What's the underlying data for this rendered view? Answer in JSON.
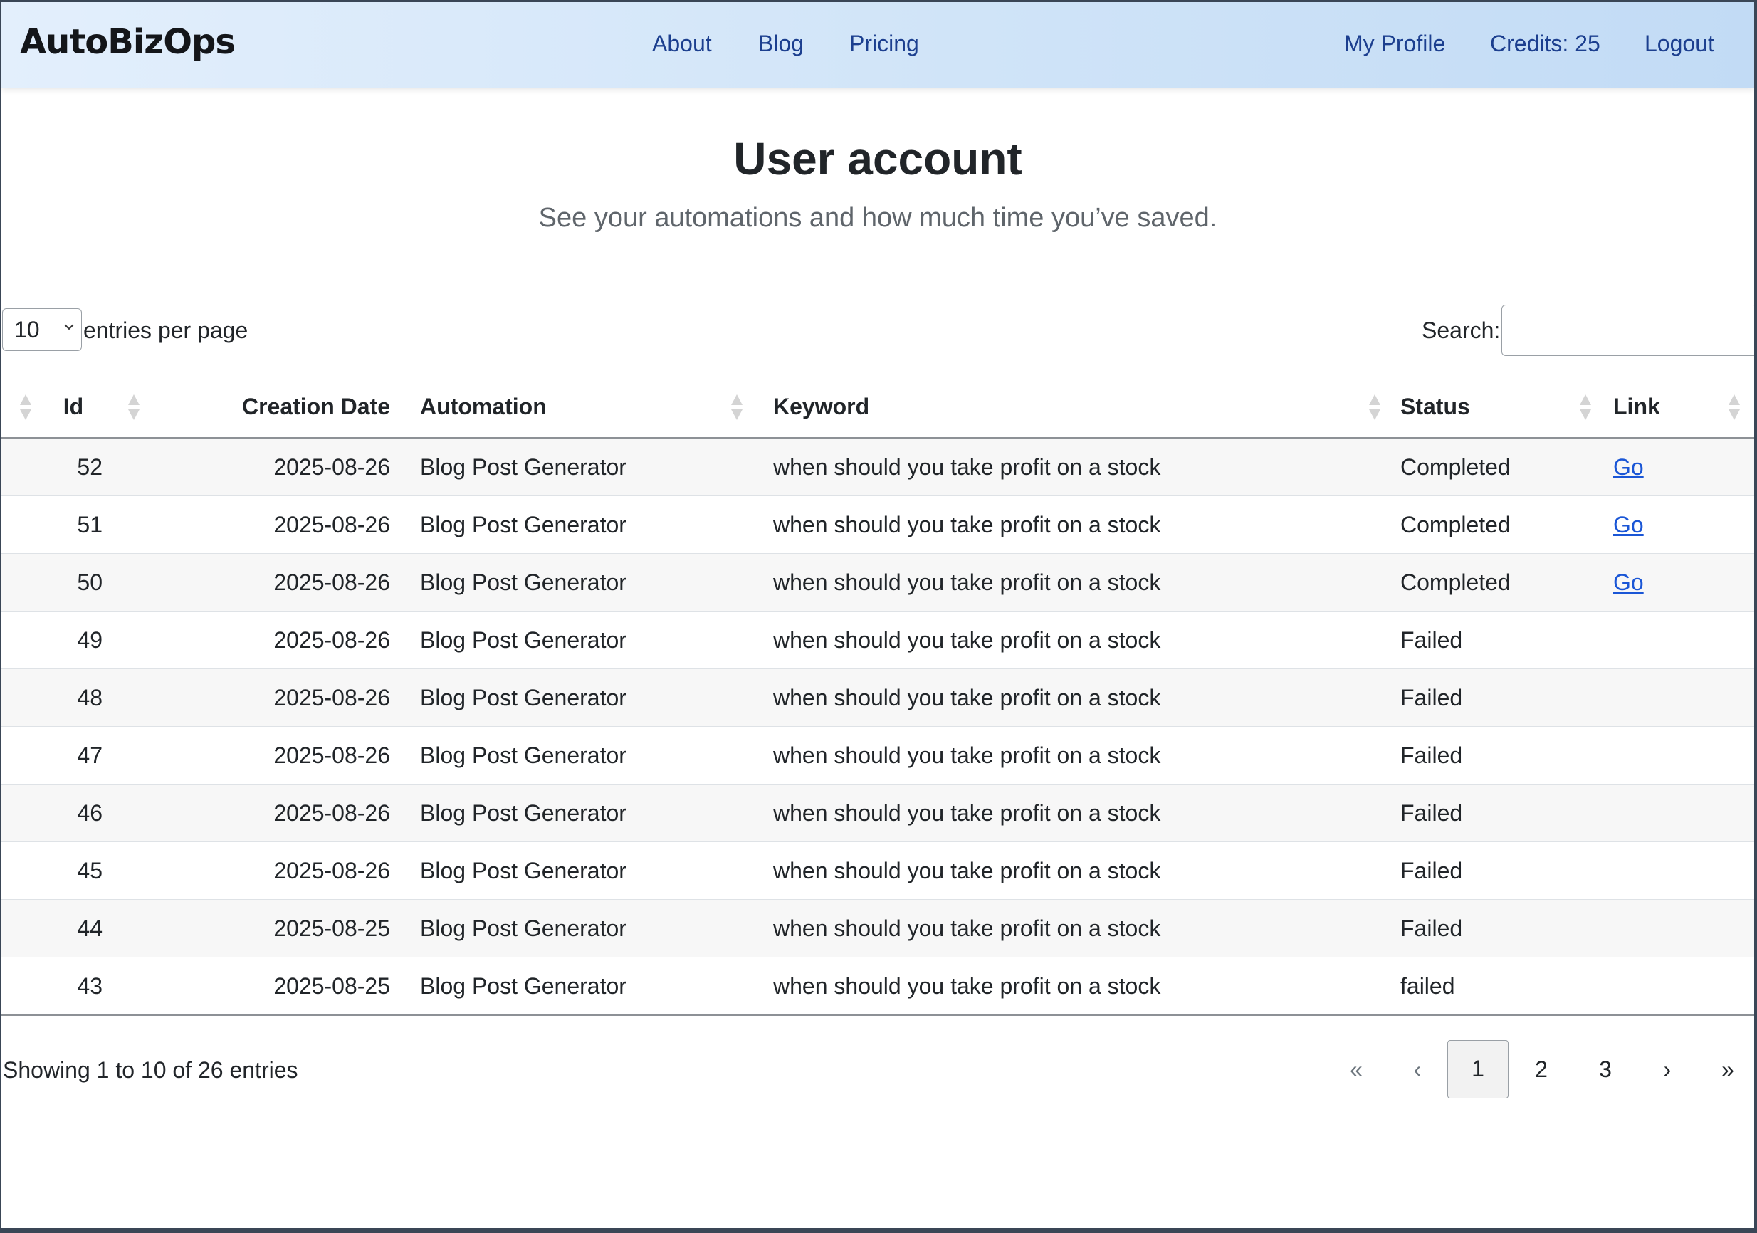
{
  "navbar": {
    "brand": "AutoBizOps",
    "links": [
      "About",
      "Blog",
      "Pricing"
    ],
    "right_links": [
      "My Profile",
      "Credits: 25",
      "Logout"
    ]
  },
  "header": {
    "title": "User account",
    "subtitle": "See your automations and how much time you’ve saved."
  },
  "controls": {
    "page_length": "10",
    "page_length_label": "entries per page",
    "search_label": "Search:",
    "search_value": ""
  },
  "table": {
    "columns": [
      "Id",
      "Creation Date",
      "Automation",
      "Keyword",
      "Status",
      "Link"
    ],
    "rows": [
      {
        "id": "52",
        "date": "2025-08-26",
        "automation": "Blog Post Generator",
        "keyword": "when should you take profit on a stock",
        "status": "Completed",
        "link": "Go"
      },
      {
        "id": "51",
        "date": "2025-08-26",
        "automation": "Blog Post Generator",
        "keyword": "when should you take profit on a stock",
        "status": "Completed",
        "link": "Go"
      },
      {
        "id": "50",
        "date": "2025-08-26",
        "automation": "Blog Post Generator",
        "keyword": "when should you take profit on a stock",
        "status": "Completed",
        "link": "Go"
      },
      {
        "id": "49",
        "date": "2025-08-26",
        "automation": "Blog Post Generator",
        "keyword": "when should you take profit on a stock",
        "status": "Failed",
        "link": ""
      },
      {
        "id": "48",
        "date": "2025-08-26",
        "automation": "Blog Post Generator",
        "keyword": "when should you take profit on a stock",
        "status": "Failed",
        "link": ""
      },
      {
        "id": "47",
        "date": "2025-08-26",
        "automation": "Blog Post Generator",
        "keyword": "when should you take profit on a stock",
        "status": "Failed",
        "link": ""
      },
      {
        "id": "46",
        "date": "2025-08-26",
        "automation": "Blog Post Generator",
        "keyword": "when should you take profit on a stock",
        "status": "Failed",
        "link": ""
      },
      {
        "id": "45",
        "date": "2025-08-26",
        "automation": "Blog Post Generator",
        "keyword": "when should you take profit on a stock",
        "status": "Failed",
        "link": ""
      },
      {
        "id": "44",
        "date": "2025-08-25",
        "automation": "Blog Post Generator",
        "keyword": "when should you take profit on a stock",
        "status": "Failed",
        "link": ""
      },
      {
        "id": "43",
        "date": "2025-08-25",
        "automation": "Blog Post Generator",
        "keyword": "when should you take profit on a stock",
        "status": "failed",
        "link": ""
      }
    ]
  },
  "footer": {
    "info": "Showing 1 to 10 of 26 entries",
    "pagination": {
      "first": "«",
      "prev": "‹",
      "pages": [
        "1",
        "2",
        "3"
      ],
      "current": "1",
      "next": "›",
      "last": "»"
    }
  },
  "colors": {
    "nav_link": "#1c3f8f",
    "link": "#1a56d6",
    "stripe": "#f7f7f7"
  }
}
